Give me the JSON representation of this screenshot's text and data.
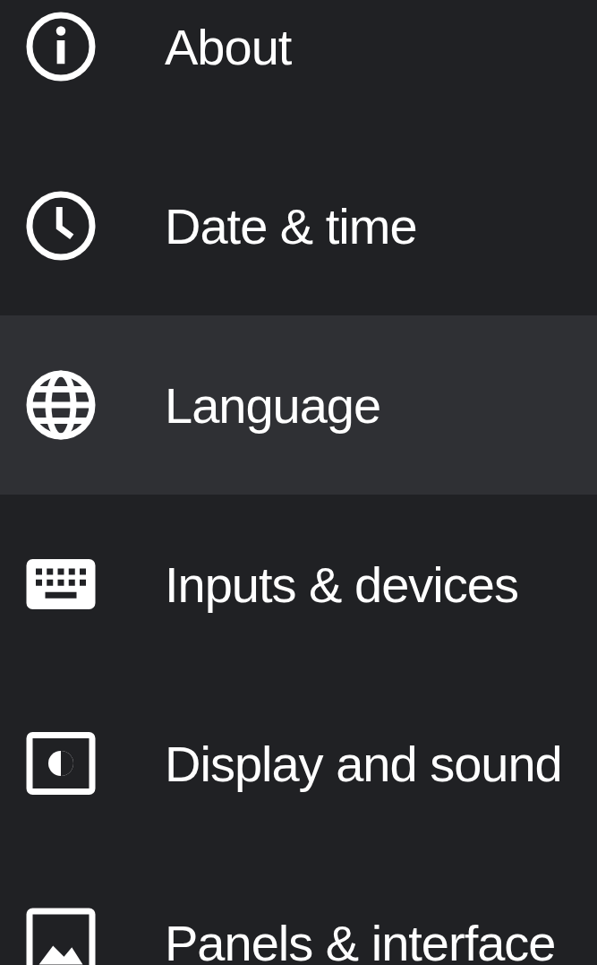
{
  "settings_menu": [
    {
      "label": "About",
      "selected": false
    },
    {
      "label": "Date & time",
      "selected": false
    },
    {
      "label": "Language",
      "selected": true
    },
    {
      "label": "Inputs & devices",
      "selected": false
    },
    {
      "label": "Display and sound",
      "selected": false
    },
    {
      "label": "Panels & interface",
      "selected": false
    }
  ]
}
